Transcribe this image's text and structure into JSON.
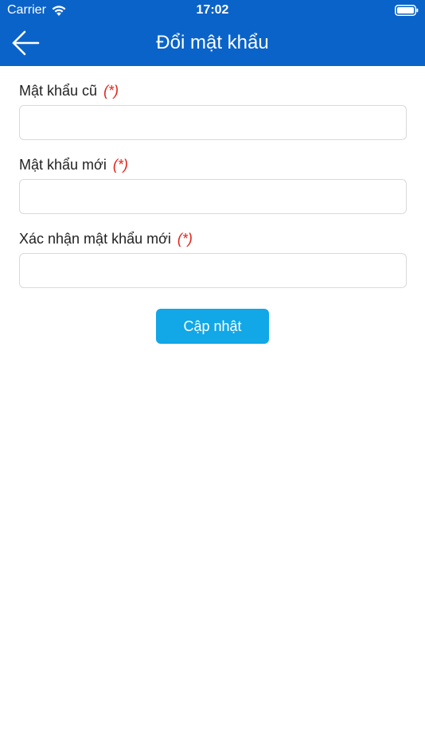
{
  "status_bar": {
    "carrier": "Carrier",
    "time": "17:02",
    "wifi_icon": "wifi-icon",
    "battery_icon": "battery-icon"
  },
  "nav": {
    "title": "Đổi mật khẩu",
    "back_icon": "arrow-left-icon"
  },
  "form": {
    "required_mark": "(*)",
    "fields": [
      {
        "label": "Mật khẩu cũ",
        "value": "",
        "placeholder": ""
      },
      {
        "label": "Mật khẩu mới",
        "value": "",
        "placeholder": ""
      },
      {
        "label": "Xác nhận mật khẩu mới",
        "value": "",
        "placeholder": ""
      }
    ],
    "submit_label": "Cập nhật"
  },
  "colors": {
    "header_bg": "#0a63c9",
    "button_bg": "#12a7e6",
    "required": "#e2231a"
  }
}
